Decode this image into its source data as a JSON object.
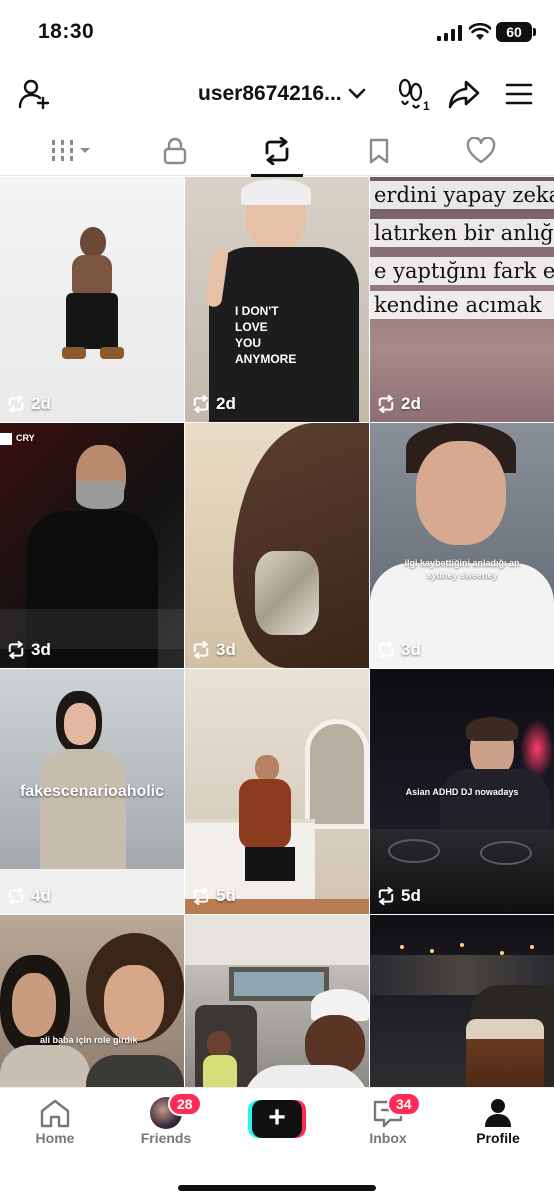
{
  "status_bar": {
    "time": "18:30",
    "battery": "60"
  },
  "header": {
    "username": "user8674216..."
  },
  "grid": [
    {
      "age": "2d",
      "caption": ""
    },
    {
      "age": "2d",
      "caption": ""
    },
    {
      "age": "2d",
      "caption_lines": [
        "erdini yapay zekay",
        "latırken bir anlığı",
        "e yaptığını fark edi",
        "kendine acımak"
      ]
    },
    {
      "age": "3d",
      "caption": "",
      "corner_label": "CRY"
    },
    {
      "age": "3d",
      "caption": ""
    },
    {
      "age": "3d",
      "caption": "ilgi kaybettiğini anladığı an\nsydney sweeney"
    },
    {
      "age": "4d",
      "caption": "fakescenarioaholic"
    },
    {
      "age": "5d",
      "caption": ""
    },
    {
      "age": "5d",
      "caption": "Asian ADHD DJ nowadays"
    },
    {
      "age": "",
      "caption": "ali baba için role girdik"
    },
    {
      "age": "",
      "caption": ""
    },
    {
      "age": "",
      "caption": ""
    }
  ],
  "nav": {
    "home": "Home",
    "friends": "Friends",
    "friends_badge": "28",
    "inbox": "Inbox",
    "inbox_badge": "34",
    "profile": "Profile"
  },
  "colors": {
    "accent_red": "#fe2c55",
    "accent_cyan": "#25f4ee"
  }
}
